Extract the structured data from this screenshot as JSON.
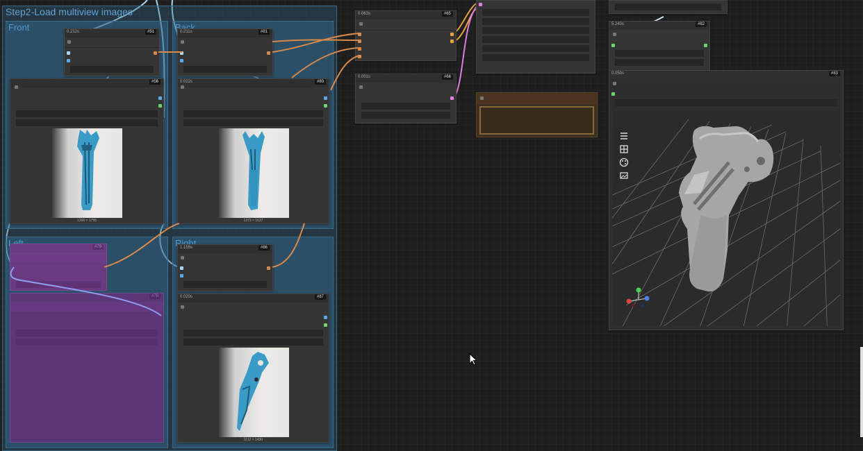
{
  "group": {
    "title": "Step2-Load multiview images"
  },
  "subgroups": {
    "front": "Front",
    "back": "Back",
    "left": "Left",
    "right": "Right"
  },
  "nodes": {
    "n51": {
      "id": "#51",
      "time": "0.212s"
    },
    "n81": {
      "id": "#81",
      "time": "0.211s"
    },
    "n56": {
      "id": "#56"
    },
    "n80": {
      "id": "#80",
      "time": "0.022s"
    },
    "n79": {
      "id": "#79"
    },
    "n78": {
      "id": "#78"
    },
    "n86": {
      "id": "#86",
      "time": "1.155s"
    },
    "n87": {
      "id": "#87",
      "time": "0.020s"
    },
    "n65": {
      "id": "#65",
      "time": "0.063s"
    },
    "n66": {
      "id": "#66",
      "time": "0.001s"
    },
    "n82": {
      "id": "#82",
      "time": "5.240s"
    },
    "n83": {
      "id": "#83",
      "time": "0.050s"
    }
  },
  "images": {
    "front_caption": "1366 × 1795",
    "back_caption": "1373 × 1637",
    "right_caption": "1112 × 1430"
  },
  "viewer": {
    "toolbar": [
      "menu-icon",
      "grid-view-icon",
      "palette-icon",
      "image-icon"
    ],
    "axis_colors": {
      "x": "#e0453f",
      "y": "#4bd15a",
      "z": "#4a80e8"
    }
  }
}
